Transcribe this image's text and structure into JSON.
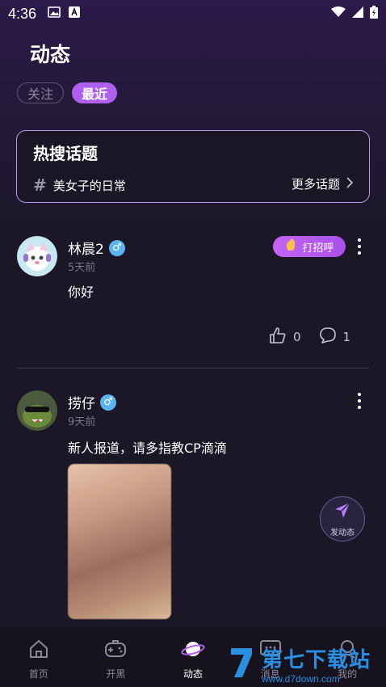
{
  "status_bar": {
    "time": "4:36"
  },
  "header": {
    "title": "动态"
  },
  "tabs": [
    {
      "label": "关注",
      "active": false
    },
    {
      "label": "最近",
      "active": true
    }
  ],
  "hot_topics": {
    "title": "热搜话题",
    "topic": "美女子的日常",
    "more_label": "更多话题"
  },
  "posts": [
    {
      "username": "林晨2",
      "gender_symbol": "♂",
      "time_ago": "5天前",
      "text": "你好",
      "greet_label": "打招呼",
      "likes": "0",
      "comments": "1"
    },
    {
      "username": "捞仔",
      "gender_symbol": "♂",
      "time_ago": "9天前",
      "text": "新人报道，请多指教CP滴滴"
    }
  ],
  "fab": {
    "label": "发动态"
  },
  "bottom_nav": [
    {
      "label": "首页",
      "icon": "home-icon"
    },
    {
      "label": "开黑",
      "icon": "gamepad-icon"
    },
    {
      "label": "动态",
      "icon": "planet-icon",
      "active": true
    },
    {
      "label": "消息",
      "icon": "message-icon"
    },
    {
      "label": "我的",
      "icon": "profile-icon"
    }
  ],
  "watermark": {
    "main": "第七下载站",
    "sub": "www.d7down.com"
  },
  "colors": {
    "accent": "#b060f0",
    "background": "#1b1726",
    "gender_badge": "#5ab4f0"
  }
}
